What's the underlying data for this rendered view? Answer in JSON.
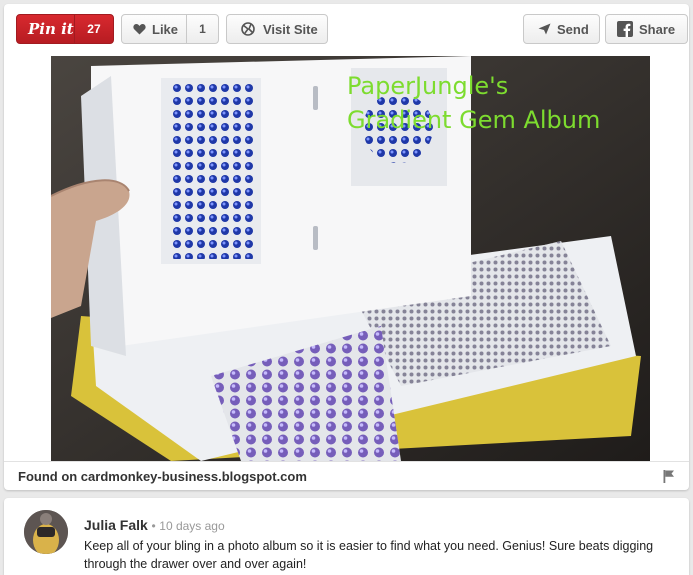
{
  "toolbar": {
    "pinit_label": "Pin it",
    "pinit_count": "27",
    "like_label": "Like",
    "like_count": "1",
    "visit_label": "Visit Site",
    "send_label": "Send",
    "share_label": "Share"
  },
  "image": {
    "overlay_line1": "PaperJungle's",
    "overlay_line2": "Gradient Gem Album"
  },
  "found": {
    "text": "Found on cardmonkey-business.blogspot.com"
  },
  "comment": {
    "author": "Julia Falk",
    "time": "10 days ago",
    "separator": "•",
    "text": "Keep all of your bling in a photo album so it is easier to find what you need. Genius! Sure beats digging through the drawer over and over again!"
  },
  "colors": {
    "pin_red": "#cb2027",
    "overlay_green": "#7ddc2f"
  },
  "icons": {
    "like": "heart-icon",
    "visit": "link-globe-icon",
    "send": "paper-plane-icon",
    "share": "facebook-icon",
    "flag": "flag-icon"
  }
}
